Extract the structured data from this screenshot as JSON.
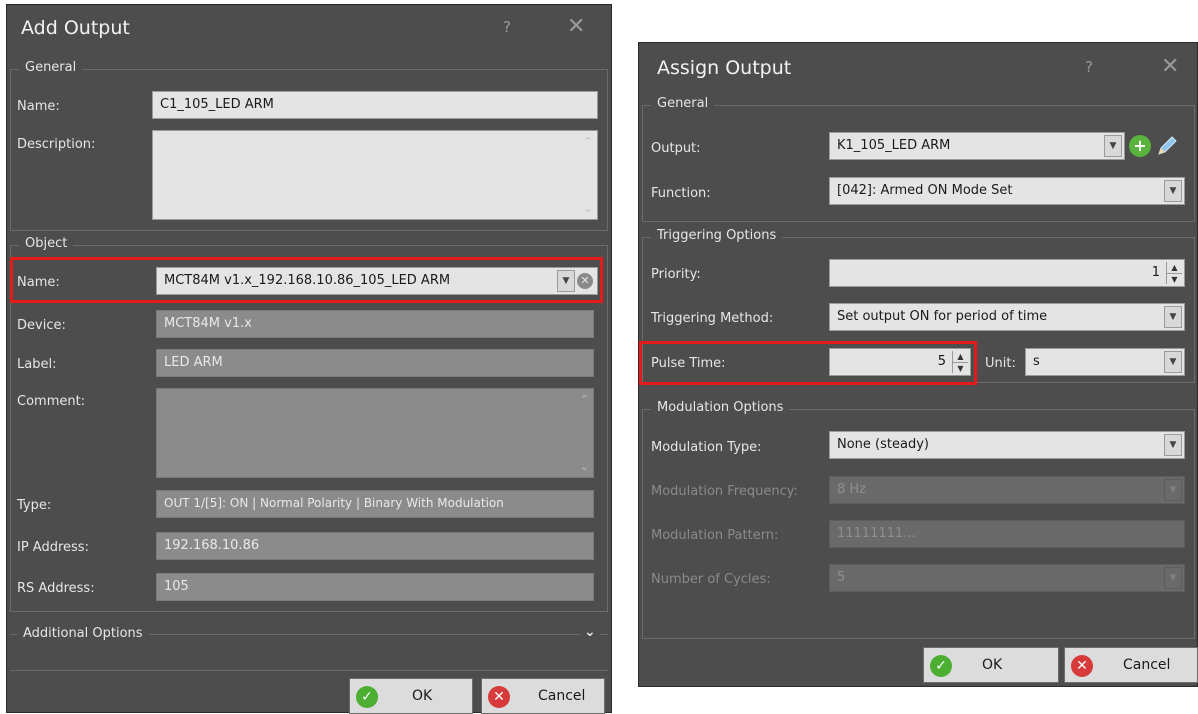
{
  "add_output": {
    "title": "Add Output",
    "help": "?",
    "close": "✕",
    "general": {
      "legend": "General",
      "name_label": "Name:",
      "name_value": "C1_105_LED ARM",
      "description_label": "Description:"
    },
    "object": {
      "legend": "Object",
      "name_label": "Name:",
      "name_value": "MCT84M v1.x_192.168.10.86_105_LED ARM",
      "device_label": "Device:",
      "device_value": "MCT84M v1.x",
      "label_label": "Label:",
      "label_value": "LED ARM",
      "comment_label": "Comment:",
      "type_label": "Type:",
      "type_value": "OUT 1/[5]: ON | Normal Polarity | Binary With Modulation",
      "ip_label": "IP Address:",
      "ip_value": "192.168.10.86",
      "rs_label": "RS Address:",
      "rs_value": "105"
    },
    "additional_options": "Additional Options",
    "ok": "OK",
    "cancel": "Cancel"
  },
  "assign_output": {
    "title": "Assign Output",
    "help": "?",
    "close": "✕",
    "general": {
      "legend": "General",
      "output_label": "Output:",
      "output_value": "K1_105_LED ARM",
      "function_label": "Function:",
      "function_value": "[042]: Armed ON  Mode Set"
    },
    "triggering": {
      "legend": "Triggering Options",
      "priority_label": "Priority:",
      "priority_value": "1",
      "method_label": "Triggering Method:",
      "method_value": "Set output ON for period of time",
      "pulse_label": "Pulse Time:",
      "pulse_value": "5",
      "unit_label": "Unit:",
      "unit_value": "s"
    },
    "modulation": {
      "legend": "Modulation Options",
      "type_label": "Modulation Type:",
      "type_value": "None (steady)",
      "frequency_label": "Modulation Frequency:",
      "frequency_value": "8 Hz",
      "pattern_label": "Modulation Pattern:",
      "pattern_value": "11111111...",
      "cycles_label": "Number of Cycles:",
      "cycles_value": "5"
    },
    "ok": "OK",
    "cancel": "Cancel"
  },
  "colors": {
    "dialog_bg": "#4d4d4d",
    "highlight": "#e51b1b",
    "ok_green": "#4caf32",
    "cancel_red": "#d63a3a"
  },
  "icons": [
    "help-icon",
    "close-icon",
    "dropdown-arrow-icon",
    "clear-icon",
    "add-icon",
    "edit-pencil-icon",
    "spin-up-icon",
    "spin-down-icon",
    "chevron-down-icon",
    "ok-check-icon",
    "cancel-x-icon"
  ]
}
